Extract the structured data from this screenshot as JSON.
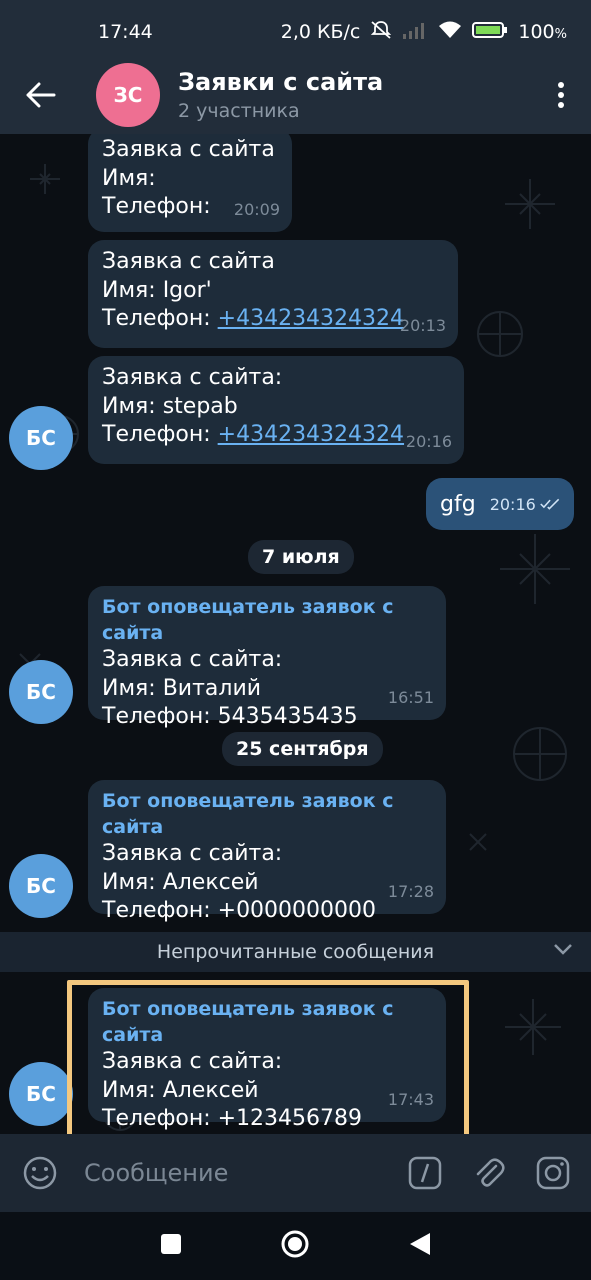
{
  "status": {
    "time": "17:44",
    "speed": "2,0 КБ/с",
    "battery": "100"
  },
  "header": {
    "avatar_initials": "ЗС",
    "title": "Заявки с сайта",
    "subtitle": "2 участника"
  },
  "messages": [
    {
      "lines": [
        "Заявка с сайта",
        "Имя:",
        "Телефон:"
      ],
      "time": "20:09"
    },
    {
      "line1": "Заявка с сайта",
      "line2": "Имя: Igor'",
      "phone_label": "Телефон: ",
      "phone": "+434234324324",
      "time": "20:13"
    },
    {
      "line1": "Заявка с сайта:",
      "line2": "Имя:  stepab",
      "phone_label": "Телефон:  ",
      "phone": "+434234324324",
      "time": "20:16",
      "avatar": "БС"
    },
    {
      "text": "gfg",
      "time": "20:16"
    },
    {
      "sender": "Бот оповещатель заявок с сайта",
      "line1": "Заявка с сайта:",
      "line2": "Имя:  Виталий",
      "line3": "Телефон:  5435435435",
      "time": "16:51",
      "avatar": "БС"
    },
    {
      "sender": "Бот оповещатель заявок с сайта",
      "line1": "Заявка с сайта:",
      "line2": "Имя:  Алексей",
      "line3": "Телефон:  +0000000000",
      "time": "17:28",
      "avatar": "БС"
    },
    {
      "sender": "Бот оповещатель заявок с сайта",
      "line1": "Заявка с сайта:",
      "line2": "Имя:  Алексей",
      "line3": "Телефон:  +123456789",
      "time": "17:43",
      "avatar": "БС"
    }
  ],
  "dates": [
    "7 июля",
    "25 сентября"
  ],
  "unread_label": "Непрочитанные сообщения",
  "input": {
    "placeholder": "Сообщение"
  },
  "colors": {
    "header_bg": "#222d3a",
    "bubble_in": "#1e2c3a",
    "bubble_out": "#2b5278",
    "accent": "#6ab2f2",
    "highlight": "#f4c87f",
    "avatar_header": "#ee6f92",
    "avatar_bot": "#5a9fdc"
  }
}
